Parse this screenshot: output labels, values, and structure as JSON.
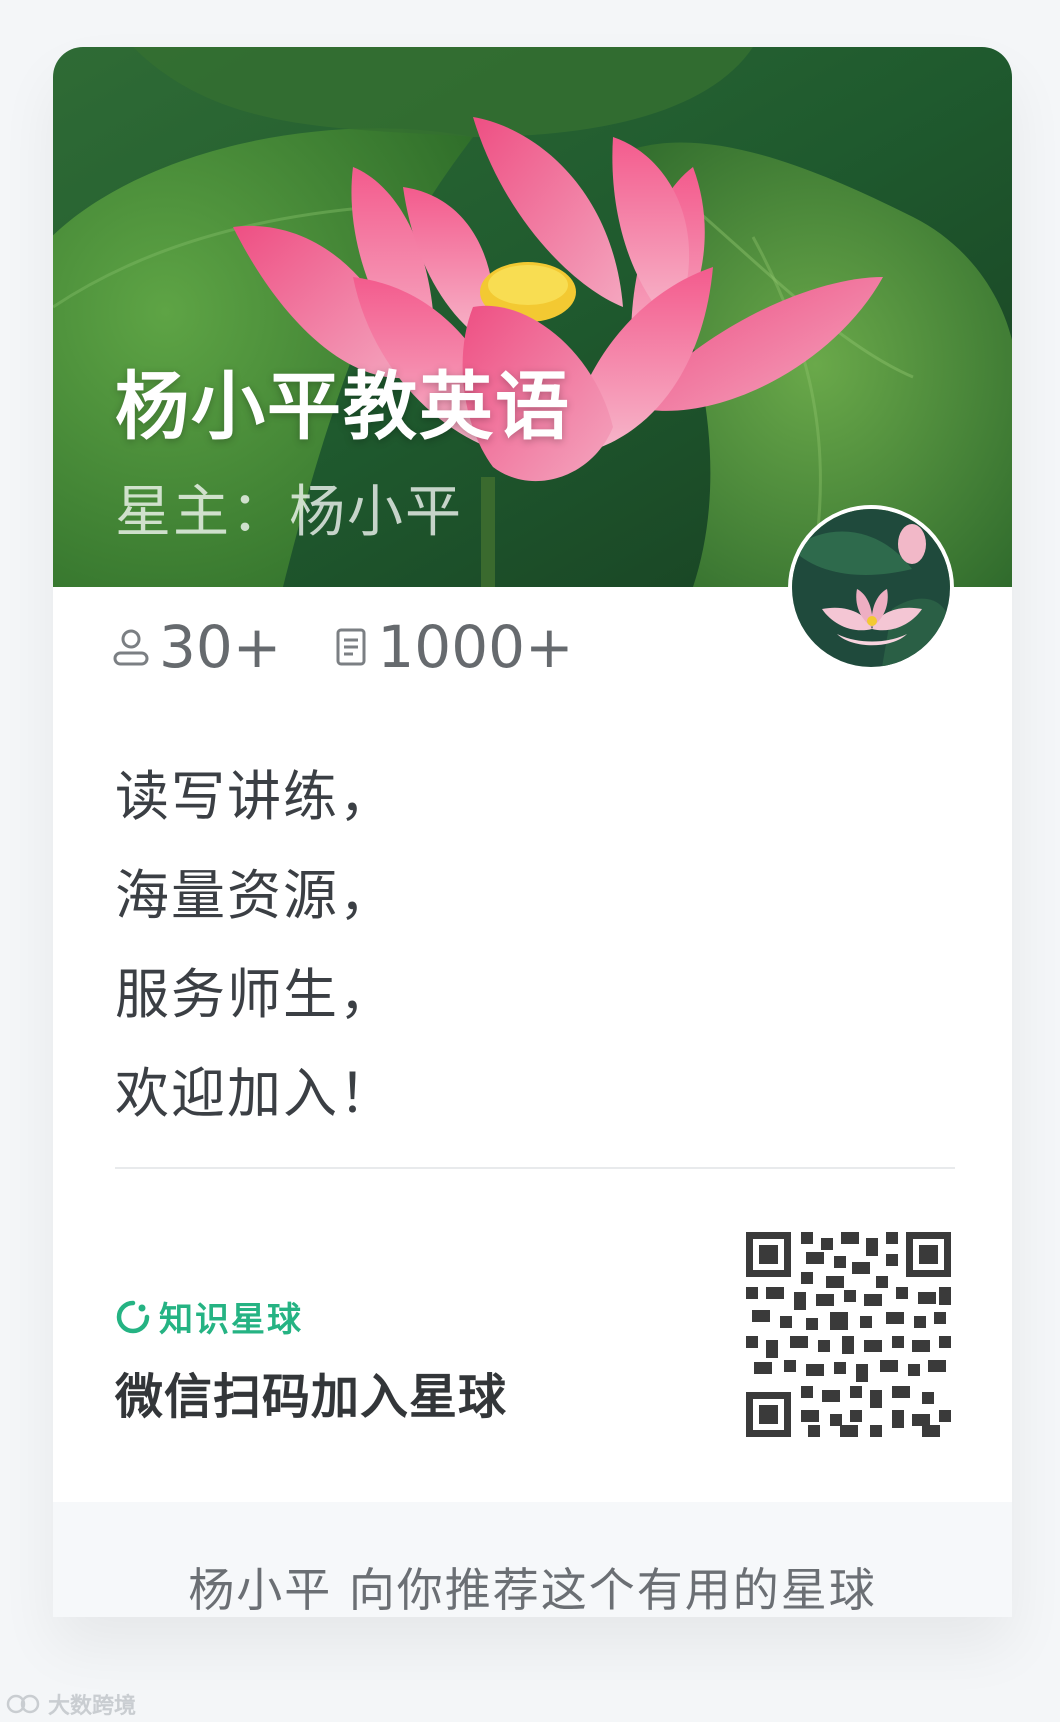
{
  "hero": {
    "title": "杨小平教英语",
    "owner": "星主：杨小平"
  },
  "stats": {
    "members": "30+",
    "posts": "1000+"
  },
  "description": {
    "lines": [
      "读写讲练，",
      "海量资源，",
      "服务师生，",
      "欢迎加入！"
    ]
  },
  "brand": {
    "label": "知识星球",
    "scan_instruction": "微信扫码加入星球"
  },
  "footer": {
    "recommend": "杨小平 向你推荐这个有用的星球"
  },
  "watermark": {
    "text": "大数跨境"
  },
  "colors": {
    "brand_green": "#25b383",
    "text_dark": "#333639",
    "text_gray": "#666a6e",
    "lotus_pink": "#e8648e",
    "leaf_green": "#3f8a3a"
  }
}
